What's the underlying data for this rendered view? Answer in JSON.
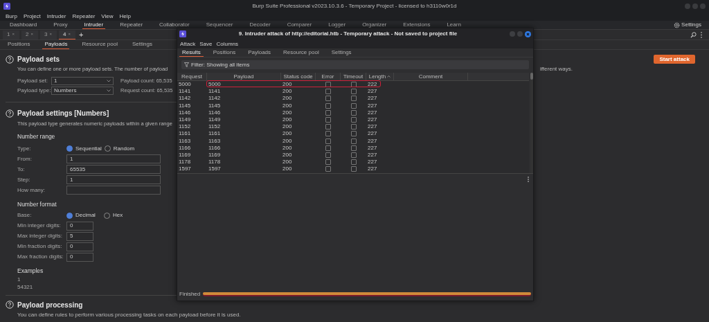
{
  "window": {
    "title": "Burp Suite Professional v2023.10.3.6 - Temporary Project - licensed to h3110w0r1d"
  },
  "menu": [
    "Burp",
    "Project",
    "Intruder",
    "Repeater",
    "View",
    "Help"
  ],
  "main_tabs": [
    {
      "label": "Dashboard",
      "selected": false
    },
    {
      "label": "Proxy",
      "selected": false
    },
    {
      "label": "Intruder",
      "selected": true
    },
    {
      "label": "Repeater",
      "selected": false
    },
    {
      "label": "Collaborator",
      "selected": false
    },
    {
      "label": "Sequencer",
      "selected": false
    },
    {
      "label": "Decoder",
      "selected": false
    },
    {
      "label": "Comparer",
      "selected": false
    },
    {
      "label": "Logger",
      "selected": false
    },
    {
      "label": "Organizer",
      "selected": false
    },
    {
      "label": "Extensions",
      "selected": false
    },
    {
      "label": "Learn",
      "selected": false
    }
  ],
  "settings_button": "Settings",
  "attack_tabs": [
    {
      "label": "1",
      "close": "×",
      "selected": false
    },
    {
      "label": "2",
      "close": "×",
      "selected": false
    },
    {
      "label": "3",
      "close": "×",
      "selected": false
    },
    {
      "label": "4",
      "close": "×",
      "selected": true
    }
  ],
  "add_tab": "+",
  "intruder_tabs": [
    {
      "label": "Positions",
      "selected": false
    },
    {
      "label": "Payloads",
      "selected": true
    },
    {
      "label": "Resource pool",
      "selected": false
    },
    {
      "label": "Settings",
      "selected": false
    }
  ],
  "payload_sets": {
    "title": "Payload sets",
    "description": "You can define one or more payload sets. The number of payload",
    "description_end": "ifferent ways.",
    "start_button": "Start attack",
    "selects": [
      {
        "label": "Payload set:",
        "value": "1"
      },
      {
        "label": "Payload type:",
        "value": "Numbers"
      }
    ],
    "counts": [
      {
        "label": "Payload count:",
        "value": "65,535"
      },
      {
        "label": "Request count:",
        "value": "65,535"
      }
    ]
  },
  "payload_settings": {
    "title": "Payload settings [Numbers]",
    "description": "This payload type generates numeric payloads within a given range",
    "number_range": {
      "title": "Number range",
      "type_label": "Type:",
      "options": [
        {
          "label": "Sequential",
          "selected": true
        },
        {
          "label": "Random",
          "selected": false
        }
      ],
      "fields": [
        {
          "label": "From:",
          "value": "1"
        },
        {
          "label": "To:",
          "value": "65535"
        },
        {
          "label": "Step:",
          "value": "1"
        },
        {
          "label": "How many:"
        }
      ]
    },
    "number_format": {
      "title": "Number format",
      "base_label": "Base:",
      "options": [
        {
          "label": "Decimal",
          "selected": true
        },
        {
          "label": "Hex",
          "selected": false
        }
      ],
      "fields": [
        {
          "label": "Min integer digits:",
          "value": "0"
        },
        {
          "label": "Max integer digits:",
          "value": "5"
        },
        {
          "label": "Min fraction digits:",
          "value": "0"
        },
        {
          "label": "Max fraction digits:",
          "value": "0"
        }
      ]
    },
    "examples": {
      "title": "Examples",
      "lines": [
        "1",
        "54321"
      ]
    }
  },
  "payload_processing": {
    "title": "Payload processing",
    "description": "You can define rules to perform various processing tasks on each payload before it is used."
  },
  "attack_window": {
    "title": "9. Intruder attack of http://editorial.htb - Temporary attack - Not saved to project file",
    "menu": [
      "Attack",
      "Save",
      "Columns"
    ],
    "tabs": [
      {
        "label": "Results",
        "selected": true
      },
      {
        "label": "Positions",
        "selected": false
      },
      {
        "label": "Payloads",
        "selected": false
      },
      {
        "label": "Resource pool",
        "selected": false
      },
      {
        "label": "Settings",
        "selected": false
      }
    ],
    "filter": "Filter: Showing all items",
    "columns": [
      {
        "label": "Request",
        "sorted": false
      },
      {
        "label": "Payload",
        "sorted": false
      },
      {
        "label": "Status code",
        "sorted": false
      },
      {
        "label": "Error",
        "sorted": false
      },
      {
        "label": "Timeout",
        "sorted": false
      },
      {
        "label": "Length",
        "sorted": true
      },
      {
        "label": "Comment",
        "sorted": false
      }
    ],
    "rows": [
      {
        "request": "5000",
        "payload": "5000",
        "status": "200",
        "error": false,
        "timeout": false,
        "length": "222",
        "highlighted": true
      },
      {
        "request": "1141",
        "payload": "1141",
        "status": "200",
        "error": false,
        "timeout": false,
        "length": "227",
        "highlighted": false
      },
      {
        "request": "1142",
        "payload": "1142",
        "status": "200",
        "error": false,
        "timeout": false,
        "length": "227",
        "highlighted": false
      },
      {
        "request": "1145",
        "payload": "1145",
        "status": "200",
        "error": false,
        "timeout": false,
        "length": "227",
        "highlighted": false
      },
      {
        "request": "1146",
        "payload": "1146",
        "status": "200",
        "error": false,
        "timeout": false,
        "length": "227",
        "highlighted": false
      },
      {
        "request": "1149",
        "payload": "1149",
        "status": "200",
        "error": false,
        "timeout": false,
        "length": "227",
        "highlighted": false
      },
      {
        "request": "1152",
        "payload": "1152",
        "status": "200",
        "error": false,
        "timeout": false,
        "length": "227",
        "highlighted": false
      },
      {
        "request": "1161",
        "payload": "1161",
        "status": "200",
        "error": false,
        "timeout": false,
        "length": "227",
        "highlighted": false
      },
      {
        "request": "1163",
        "payload": "1163",
        "status": "200",
        "error": false,
        "timeout": false,
        "length": "227",
        "highlighted": false
      },
      {
        "request": "1166",
        "payload": "1166",
        "status": "200",
        "error": false,
        "timeout": false,
        "length": "227",
        "highlighted": false
      },
      {
        "request": "1169",
        "payload": "1169",
        "status": "200",
        "error": false,
        "timeout": false,
        "length": "227",
        "highlighted": false
      },
      {
        "request": "1178",
        "payload": "1178",
        "status": "200",
        "error": false,
        "timeout": false,
        "length": "227",
        "highlighted": false
      },
      {
        "request": "1597",
        "payload": "1597",
        "status": "200",
        "error": false,
        "timeout": false,
        "length": "227",
        "highlighted": false
      }
    ],
    "status": "Finished",
    "progress": {
      "level": 1
    }
  }
}
